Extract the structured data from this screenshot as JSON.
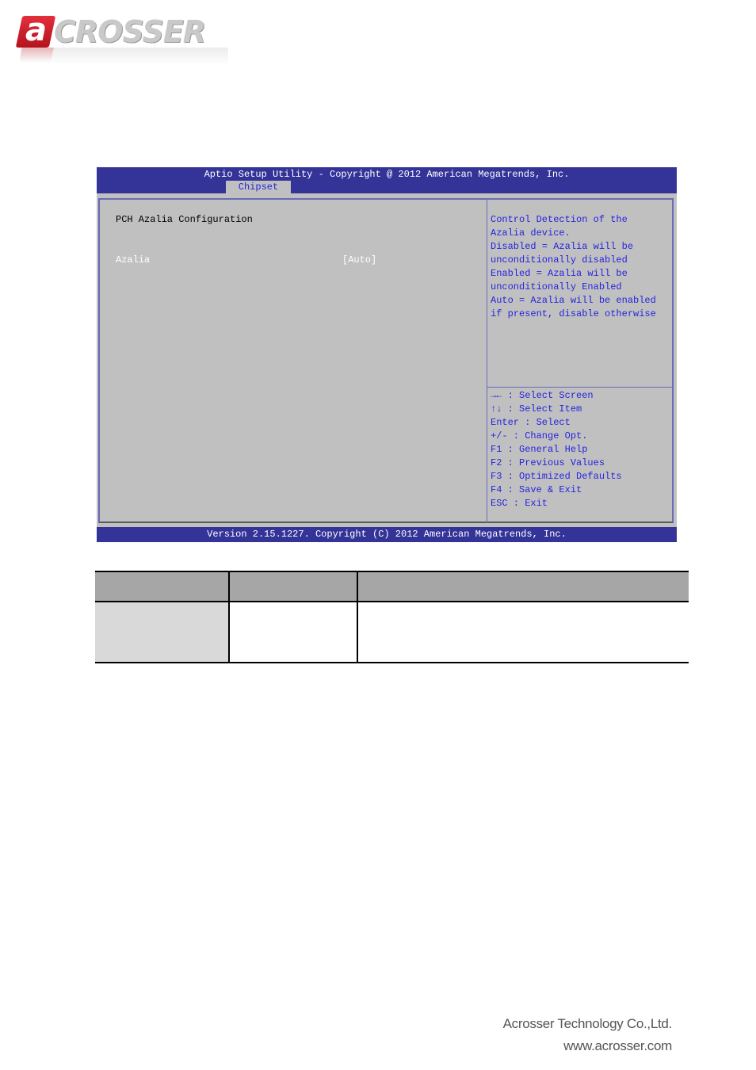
{
  "logo": {
    "mark_letter": "a",
    "wordmark": "CROSSER",
    "brand_color": "#c8102e"
  },
  "bios": {
    "title": "Aptio Setup Utility - Copyright @ 2012 American Megatrends, Inc.",
    "active_tab": "Chipset",
    "section_title": "PCH Azalia Configuration",
    "settings": [
      {
        "label": "Azalia",
        "value": "[Auto]"
      }
    ],
    "help_lines": [
      "Control Detection of the",
      "Azalia device.",
      "Disabled = Azalia will be",
      "unconditionally disabled",
      "Enabled = Azalia will be",
      "unconditionally Enabled",
      "Auto = Azalia will be enabled",
      "if present, disable otherwise"
    ],
    "key_help": [
      {
        "icon": "left-right-arrows-icon",
        "text": "→← : Select Screen"
      },
      {
        "icon": "up-down-arrows-icon",
        "text": "↑↓ : Select Item"
      },
      {
        "text": "Enter : Select"
      },
      {
        "text": "+/- : Change Opt."
      },
      {
        "text": "F1 : General Help"
      },
      {
        "text": "F2 : Previous Values"
      },
      {
        "text": "F3 : Optimized Defaults"
      },
      {
        "text": "F4 : Save & Exit"
      },
      {
        "text": "ESC : Exit"
      }
    ],
    "footer": "Version 2.15.1227. Copyright (C) 2012 American Megatrends, Inc.",
    "colors": {
      "bar": "#343398",
      "panel": "#c0c0c0",
      "help_text": "#2424e0",
      "tab_text": "#2424e0"
    }
  },
  "table": {
    "headers": [
      "",
      "",
      ""
    ],
    "rows": [
      [
        "",
        "",
        ""
      ]
    ]
  },
  "footer": {
    "company": "Acrosser Technology Co.,Ltd.",
    "website": "www.acrosser.com"
  }
}
